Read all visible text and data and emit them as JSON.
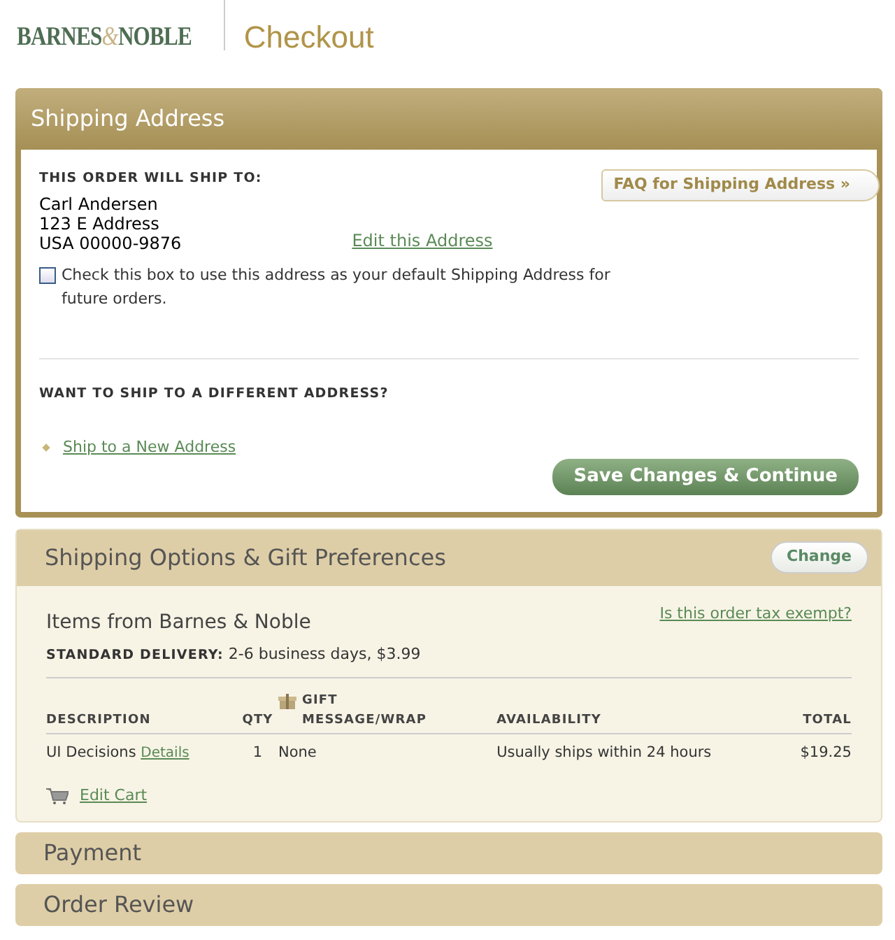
{
  "header": {
    "logo": [
      "BARNES",
      "&",
      "NOBLE"
    ],
    "title": "Checkout"
  },
  "shipping_address": {
    "title": "Shipping Address",
    "ship_to_label": "THIS ORDER WILL SHIP TO:",
    "address_lines": [
      "Carl Andersen",
      "123 E Address",
      "USA 00000-9876"
    ],
    "edit_link": "Edit this Address",
    "faq_button": "FAQ for Shipping Address",
    "faq_arrow": "»",
    "default_checkbox": {
      "label": "Check this box to use this address as your default Shipping Address for future orders.",
      "checked": false
    },
    "different_label": "WANT TO SHIP TO A DIFFERENT ADDRESS?",
    "new_address_link": "Ship to a New Address",
    "save_button": "Save Changes & Continue"
  },
  "shipping_options": {
    "title": "Shipping Options & Gift Preferences",
    "change_button": "Change",
    "items_title": "Items from Barnes & Noble",
    "tax_link": "Is this order tax exempt?",
    "delivery_label": "STANDARD DELIVERY:",
    "delivery_value": "2-6 business days, $3.99",
    "table": {
      "columns": [
        "DESCRIPTION",
        "QTY",
        "GIFT MESSAGE/WRAP",
        "AVAILABILITY",
        "TOTAL"
      ],
      "rows": [
        {
          "description": "UI Decisions",
          "details_link": "Details",
          "qty": "1",
          "gift": "None",
          "availability": "Usually ships within 24 hours",
          "total": "$19.25"
        }
      ]
    },
    "edit_cart_link": "Edit Cart"
  },
  "collapsed_sections": [
    "Payment",
    "Order Review"
  ]
}
